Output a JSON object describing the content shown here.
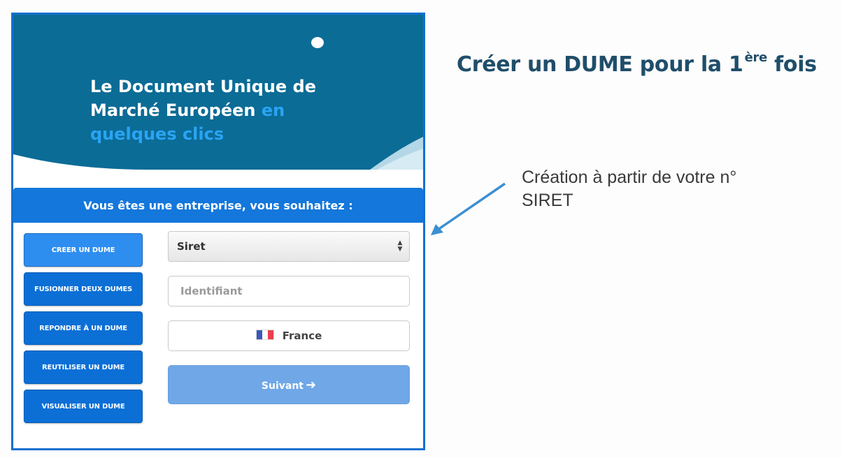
{
  "hero": {
    "title": "Le Document Unique de Marché Européen",
    "title_accent": "en quelques clics"
  },
  "panel": {
    "header": "Vous êtes une entreprise, vous souhaitez :"
  },
  "menu": {
    "items": [
      {
        "label": "CREER UN DUME"
      },
      {
        "label": "FUSIONNER DEUX DUMES"
      },
      {
        "label": "REPONDRE À UN DUME"
      },
      {
        "label": "REUTILISER UN DUME"
      },
      {
        "label": "VISUALISER UN DUME"
      }
    ]
  },
  "form": {
    "id_type_selected": "Siret",
    "identifier_placeholder": "Identifiant",
    "country": "France",
    "next_label": "Suivant"
  },
  "slide": {
    "title": "Créer un DUME pour la 1",
    "title_sup": "ère",
    "title_end": "fois",
    "caption": "Création à partir de votre n° SIRET"
  },
  "colors": {
    "hero_bg": "#0b6c96",
    "accent_blue": "#2aa4f4",
    "panel_header": "#1477db",
    "button_blue": "#0b6fd6",
    "next_button": "#6fa7e7",
    "arrow": "#3d8fd0",
    "title_color": "#1f4e6a"
  }
}
